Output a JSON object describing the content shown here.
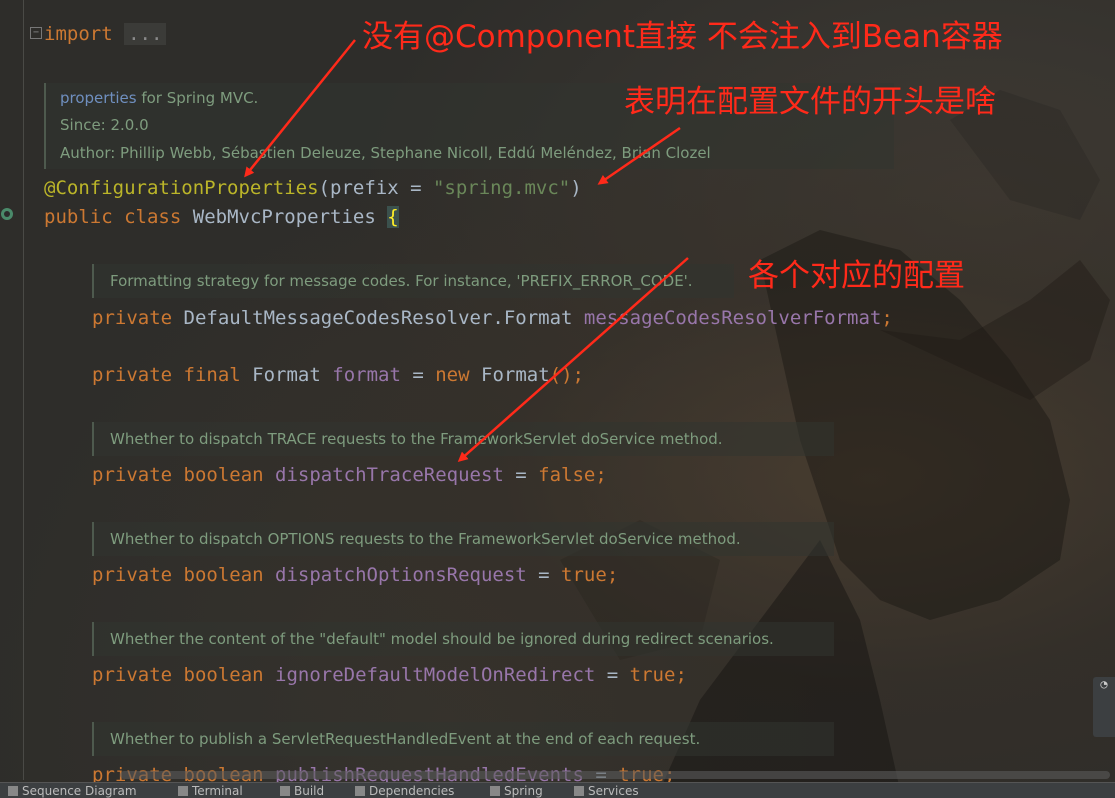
{
  "code": {
    "import_kw": "import",
    "import_collapsed": "...",
    "annotation": "@ConfigurationProperties",
    "annotation_param": "prefix",
    "annotation_value": "\"spring.mvc\"",
    "class_decl_public": "public",
    "class_decl_class": "class",
    "class_name": "WebMvcProperties",
    "open_brace": "{",
    "fields": [
      {
        "modifiers": "private",
        "type": "DefaultMessageCodesResolver.Format",
        "name": "messageCodesResolverFormat",
        "tail": ";"
      },
      {
        "modifiers": "private final",
        "type": "Format",
        "name": "format",
        "assign": " = ",
        "value_kw": "new",
        "value": "Format",
        "tail": "();"
      },
      {
        "modifiers": "private boolean",
        "name": "dispatchTraceRequest",
        "assign": " = ",
        "value_kw": "false",
        "tail": ";"
      },
      {
        "modifiers": "private boolean",
        "name": "dispatchOptionsRequest",
        "assign": " = ",
        "value_kw": "true",
        "tail": ";"
      },
      {
        "modifiers": "private boolean",
        "name": "ignoreDefaultModelOnRedirect",
        "assign": " = ",
        "value_kw": "true",
        "tail": ";"
      },
      {
        "modifiers": "private boolean",
        "name": "publishRequestHandledEvents",
        "assign": " = ",
        "value_kw": "true",
        "tail": ";"
      }
    ]
  },
  "docs": {
    "class_doc": {
      "link": "properties",
      "line1_rest": " for Spring MVC.",
      "since": "Since:    2.0.0",
      "author": "Author: Phillip Webb, Sébastien Deleuze, Stephane Nicoll, Eddú Meléndez, Brian Clozel"
    },
    "field_docs": [
      "Formatting strategy for message codes. For instance, 'PREFIX_ERROR_CODE'.",
      "Whether to dispatch TRACE requests to the FrameworkServlet doService method.",
      "Whether to dispatch OPTIONS requests to the FrameworkServlet doService method.",
      "Whether the content of the \"default\" model should be ignored during redirect scenarios.",
      "Whether to publish a ServletRequestHandledEvent at the end of each request."
    ]
  },
  "annotations_overlay": {
    "note1": "没有@Component直接 不会注入到Bean容器",
    "note2": "表明在配置文件的开头是啥",
    "note3": "各个对应的配置",
    "color": "#ff2a1a"
  },
  "statusbar": {
    "items": [
      "Sequence Diagram",
      "Terminal",
      "Build",
      "Dependencies",
      "Spring",
      "Services"
    ]
  }
}
